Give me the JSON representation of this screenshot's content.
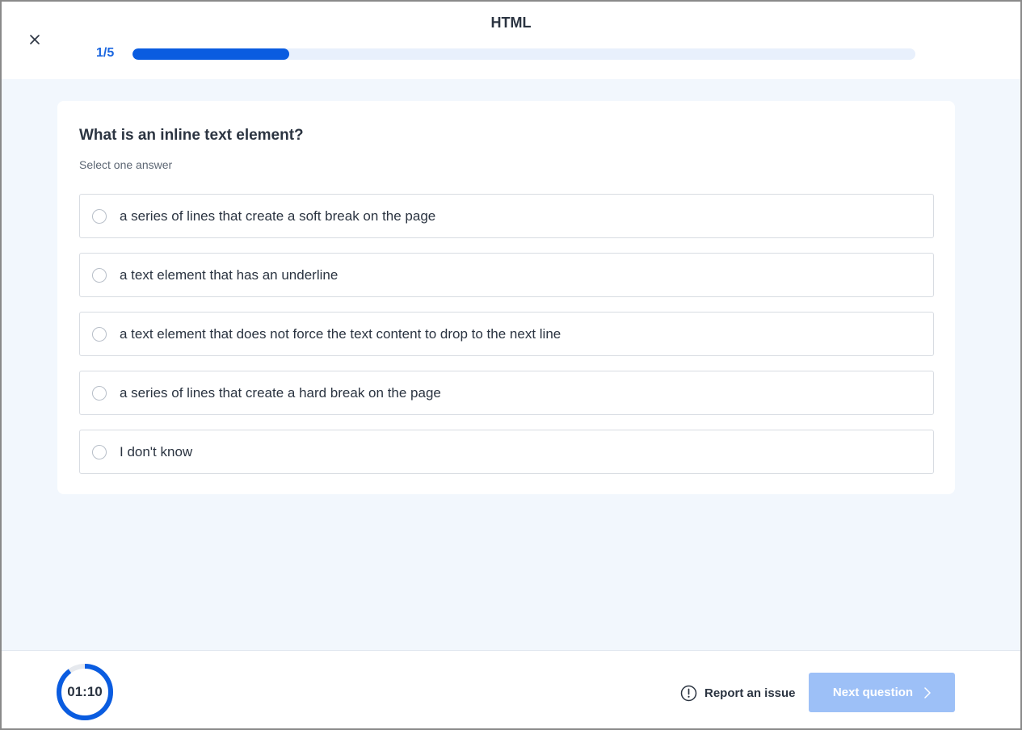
{
  "header": {
    "title": "HTML",
    "progress_text": "1/5",
    "progress_fraction": 0.2
  },
  "question": {
    "text": "What is an inline text element?",
    "hint": "Select one answer",
    "options": [
      {
        "label": "a series of lines that create a soft break on the page"
      },
      {
        "label": "a text element that has an underline"
      },
      {
        "label": "a text element that does not force the text content to drop to the next line"
      },
      {
        "label": "a series of lines that create a hard break on the page"
      },
      {
        "label": "I don't know"
      }
    ]
  },
  "footer": {
    "timer": "01:10",
    "timer_fraction_remaining": 0.9,
    "report_label": "Report an issue",
    "next_label": "Next question"
  },
  "colors": {
    "accent": "#0a5ce0",
    "next_button_disabled": "#9dc0f7",
    "background": "#f2f7fd"
  },
  "icons": {
    "close": "close-icon",
    "report": "exclamation-circle-icon",
    "next": "chevron-right-icon"
  }
}
